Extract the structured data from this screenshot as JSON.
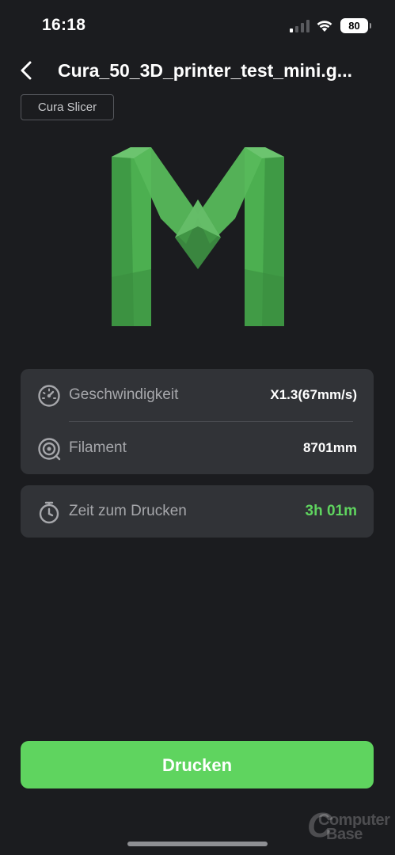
{
  "status_bar": {
    "time": "16:18",
    "battery_level": "80",
    "signal_bars_active": 1,
    "signal_bars_total": 4
  },
  "header": {
    "title": "Cura_50_3D_printer_test_mini.g...",
    "back_icon": "chevron-left-icon"
  },
  "slicer_tag": "Cura Slicer",
  "model_preview": {
    "icon": "m-letter-3d-model",
    "color": "#4caf50"
  },
  "info_card": {
    "speed": {
      "icon": "speedometer-icon",
      "label": "Geschwindigkeit",
      "value": "X1.3(67mm/s)"
    },
    "filament": {
      "icon": "filament-spool-icon",
      "label": "Filament",
      "value": "8701mm"
    }
  },
  "time_card": {
    "icon": "stopwatch-icon",
    "label": "Zeit zum Drucken",
    "value": "3h 01m",
    "value_color": "#5fd45f"
  },
  "print_button": {
    "label": "Drucken",
    "color": "#5fd45f"
  },
  "watermark": {
    "line1": "Computer",
    "line2": "Base",
    "letter": "C"
  }
}
